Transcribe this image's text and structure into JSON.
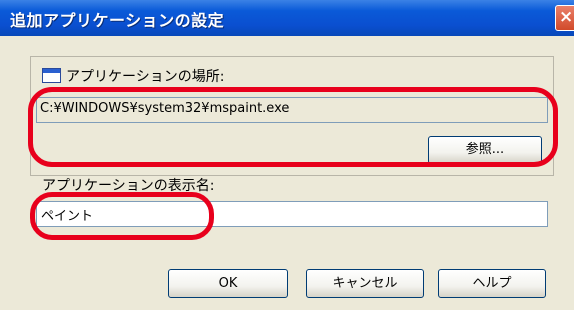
{
  "window": {
    "title": "追加アプリケーションの設定",
    "close_glyph": "×"
  },
  "location": {
    "label": "アプリケーションの場所:",
    "path_value": "C:¥WINDOWS¥system32¥mspaint.exe",
    "browse_label": "参照..."
  },
  "display_name": {
    "label": "アプリケーションの表示名:",
    "value": "ペイント"
  },
  "buttons": {
    "ok": "OK",
    "cancel": "キャンセル",
    "help": "ヘルプ"
  },
  "colors": {
    "highlight": "#e8001c",
    "titlebar": "#0a5ad8",
    "dialog_bg": "#ece9d8"
  }
}
